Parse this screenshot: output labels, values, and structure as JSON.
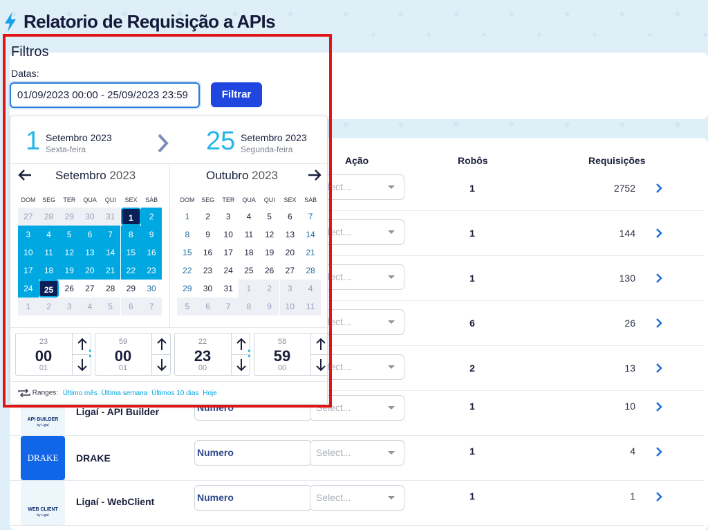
{
  "header": {
    "title": "Relatorio de Requisição a APIs"
  },
  "filters": {
    "heading": "Filtros",
    "dates_label": "Datas:",
    "date_range_value": "01/09/2023 00:00 - 25/09/2023 23:59",
    "filter_button": "Filtrar"
  },
  "table": {
    "columns": {
      "acao": "Ação",
      "robos": "Robôs",
      "requisicoes": "Requisições"
    },
    "select_placeholder": "Select...",
    "number_placeholder": "Numero",
    "rows": [
      {
        "bot": "",
        "robos": "1",
        "requisicoes": "2752"
      },
      {
        "bot": "",
        "robos": "1",
        "requisicoes": "144"
      },
      {
        "bot": "",
        "robos": "1",
        "requisicoes": "130"
      },
      {
        "bot": "",
        "robos": "6",
        "requisicoes": "26"
      },
      {
        "bot": "",
        "robos": "2",
        "requisicoes": "13"
      },
      {
        "bot": "Ligaí - API Builder",
        "robos": "1",
        "requisicoes": "10",
        "logo_text": "API BUILDER",
        "logo_sub": "by Ligaí"
      },
      {
        "bot": "DRAKE",
        "robos": "1",
        "requisicoes": "4",
        "logo_text": "DRAKE"
      },
      {
        "bot": "Ligaí - WebClient",
        "robos": "1",
        "requisicoes": "1",
        "logo_text": "WEB CLIENT",
        "logo_sub": "by Ligaí"
      }
    ]
  },
  "datepicker": {
    "start": {
      "day": "1",
      "month": "Setembro 2023",
      "weekday": "Sexta-feira"
    },
    "end": {
      "day": "25",
      "month": "Setembro 2023",
      "weekday": "Segunda-feira"
    },
    "left_month": {
      "name": "Setembro",
      "year": "2023"
    },
    "right_month": {
      "name": "Outubro",
      "year": "2023"
    },
    "weekdays": [
      "DOM",
      "SEG",
      "TER",
      "QUA",
      "QUI",
      "SEX",
      "SÁB"
    ],
    "left_days": [
      "27",
      "28",
      "29",
      "30",
      "31",
      "1",
      "2",
      "3",
      "4",
      "5",
      "6",
      "7",
      "8",
      "9",
      "10",
      "11",
      "12",
      "13",
      "14",
      "15",
      "16",
      "17",
      "18",
      "19",
      "20",
      "21",
      "22",
      "23",
      "24",
      "25",
      "26",
      "27",
      "28",
      "29",
      "30",
      "1",
      "2",
      "3",
      "4",
      "5",
      "6",
      "7"
    ],
    "right_days": [
      "1",
      "2",
      "3",
      "4",
      "5",
      "6",
      "7",
      "8",
      "9",
      "10",
      "11",
      "12",
      "13",
      "14",
      "15",
      "16",
      "17",
      "18",
      "19",
      "20",
      "21",
      "22",
      "23",
      "24",
      "25",
      "26",
      "27",
      "28",
      "29",
      "30",
      "31",
      "1",
      "2",
      "3",
      "4",
      "5",
      "6",
      "7",
      "8",
      "9",
      "10",
      "11"
    ],
    "time_start": {
      "hour_prev": "23",
      "hour": "00",
      "hour_next": "01",
      "min_prev": "59",
      "min": "00",
      "min_next": "01"
    },
    "time_end": {
      "hour_prev": "22",
      "hour": "23",
      "hour_next": "00",
      "min_prev": "58",
      "min": "59",
      "min_next": "00"
    },
    "ranges_label": "Ranges:",
    "ranges": [
      "Último mês",
      "Última semana",
      "Últimos 10 dias",
      "Hoje"
    ]
  },
  "colors": {
    "accent": "#00a8e2",
    "primary_button": "#1f47e0",
    "highlight_frame": "#e11515"
  }
}
